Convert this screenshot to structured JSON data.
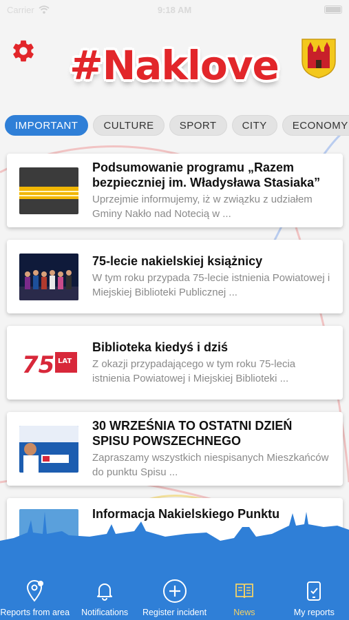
{
  "status_bar": {
    "carrier": "Carrier",
    "time": "9:18 AM"
  },
  "header": {
    "logo_text": "#Naklove",
    "settings_icon": "gear-icon",
    "coat_of_arms": "coat-of-arms-image"
  },
  "categories": [
    {
      "label": "IMPORTANT",
      "active": true
    },
    {
      "label": "CULTURE",
      "active": false
    },
    {
      "label": "SPORT",
      "active": false
    },
    {
      "label": "CITY",
      "active": false
    },
    {
      "label": "ECONOMY",
      "active": false
    }
  ],
  "news": [
    {
      "title": "Podsumowanie programu „Razem bezpieczniej im. Władysława Stasiaka”",
      "desc": "Uprzejmie informujemy, iż w związku z udziałem Gminy Nakło nad Notecią w ..."
    },
    {
      "title": "75-lecie nakielskiej książnicy",
      "desc": "W tym roku przypada 75-lecie istnienia Powiatowej i Miejskiej Biblioteki Publicznej ..."
    },
    {
      "title": "Biblioteka kiedyś i dziś",
      "desc": "Z okazji przypadającego w tym roku 75-lecia istnienia Powiatowej i Miejskiej Biblioteki ..."
    },
    {
      "title": "30 WRZEŚNIA TO OSTATNI DZIEŃ SPISU POWSZECHNEGO",
      "desc": "Zapraszamy wszystkich niespisanych Mieszkańców do punktu Spisu ..."
    },
    {
      "title": "Informacja Nakielskiego Punktu",
      "desc": ""
    }
  ],
  "thumb_text": {
    "lat": "LAT"
  },
  "tabbar": [
    {
      "label": "Reports from area",
      "icon": "map-pin-icon",
      "active": false
    },
    {
      "label": "Notifications",
      "icon": "bell-icon",
      "active": false
    },
    {
      "label": "Register incident",
      "icon": "plus-circle-icon",
      "active": false
    },
    {
      "label": "News",
      "icon": "news-icon",
      "active": true
    },
    {
      "label": "My reports",
      "icon": "phone-list-icon",
      "active": false
    }
  ],
  "colors": {
    "accent": "#2f7fd7",
    "logo_red": "#e2262a",
    "skyline_blue": "#2f7fd7",
    "active_tab_label": "#f3d267"
  }
}
